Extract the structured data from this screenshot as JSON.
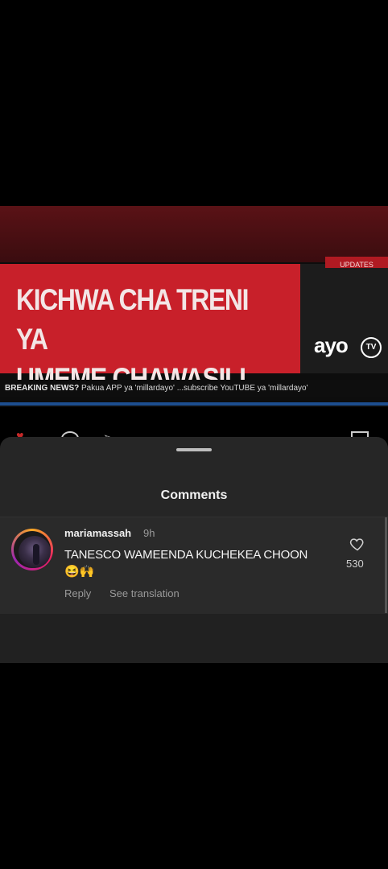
{
  "video": {
    "headline": "KICHWA CHA TRENI YA\nUMEME CHAWASILI TZ",
    "updates_tag": "UPDATES",
    "logo": "ayo",
    "logo_badge": "TV",
    "ticker_label": "BREAKING NEWS?",
    "ticker_text": "Pakua APP ya 'millardayo' ...subscribe YouTUBE ya 'millardayo'",
    "colors": {
      "headline_bg": "#c8202a",
      "ticker_bar": "#1d4e8f"
    }
  },
  "actions": {
    "like_icon": "heart-icon",
    "comment_icon": "comment-icon",
    "share_icon": "send-icon",
    "save_icon": "bookmark-icon"
  },
  "sheet": {
    "title": "Comments"
  },
  "comment": {
    "username": "mariamassah",
    "time": "9h",
    "text": "TANESCO WAMEENDA KUCHEKEA CHOON",
    "emoji": "😆🙌",
    "reply_label": "Reply",
    "translation_label": "See translation",
    "like_count": "530",
    "avatar_icon": "avatar"
  }
}
